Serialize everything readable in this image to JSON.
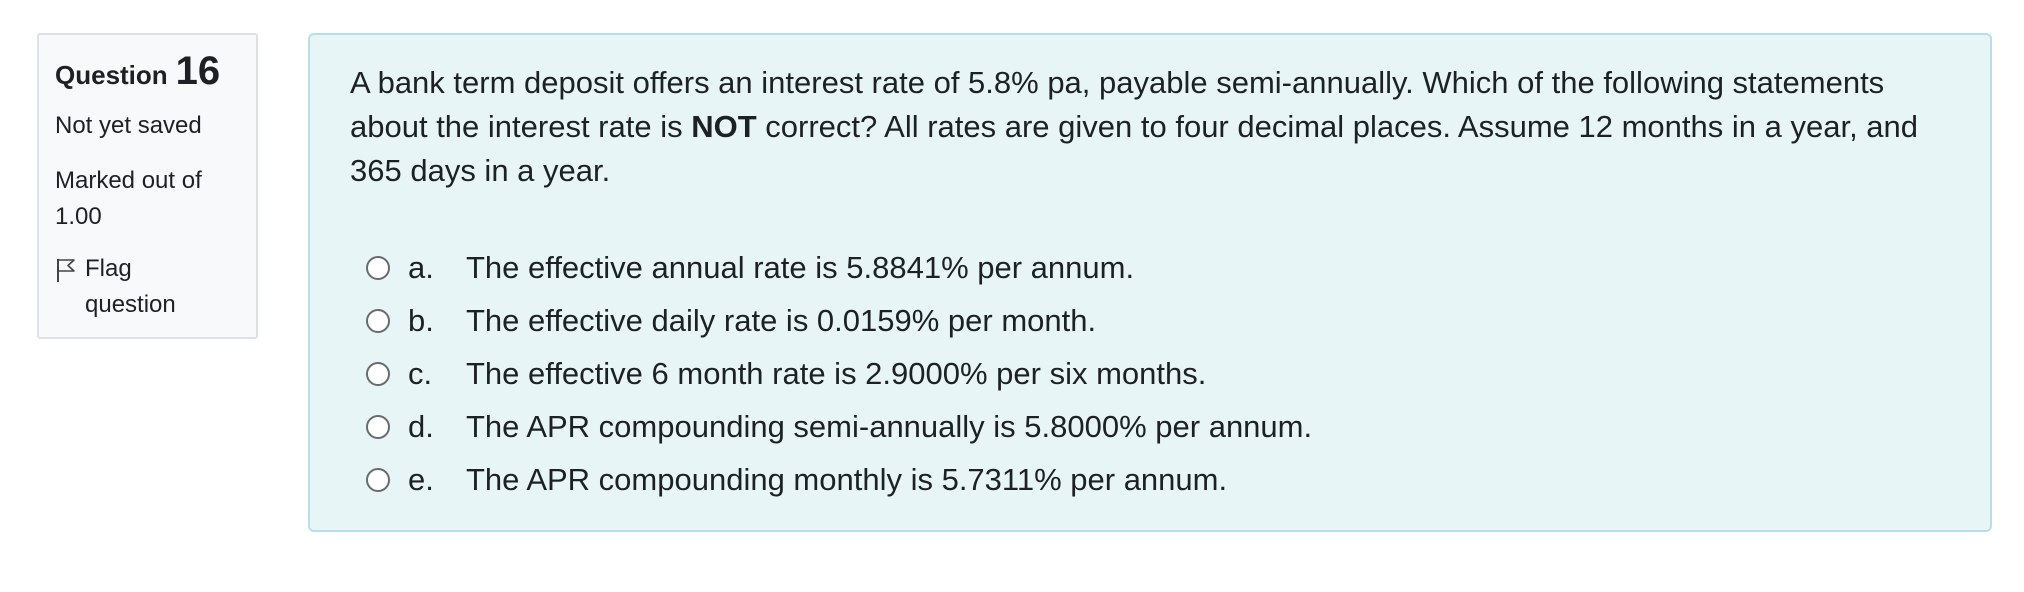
{
  "info": {
    "question_label": "Question",
    "question_number": "16",
    "state": "Not yet saved",
    "marks_line1": "Marked out of",
    "marks_line2": "1.00",
    "flag_line1": "Flag",
    "flag_line2": "question",
    "flag_icon": "flag-outline-icon"
  },
  "question": {
    "text_part1": "A bank term deposit offers an interest rate of 5.8% pa, payable semi-annually. Which of the following statements about the interest rate is ",
    "text_bold": "NOT",
    "text_part2": " correct? All rates are given to four decimal places. Assume 12 months in a year, and 365 days in a year.",
    "answers": [
      {
        "letter": "a.",
        "text": "The effective annual rate is 5.8841% per annum."
      },
      {
        "letter": "b.",
        "text": "The effective daily rate is 0.0159% per month."
      },
      {
        "letter": "c.",
        "text": "The effective 6 month rate is 2.9000% per six months."
      },
      {
        "letter": "d.",
        "text": "The APR compounding semi-annually is 5.8000% per annum."
      },
      {
        "letter": "e.",
        "text": "The APR compounding monthly is 5.7311% per annum."
      }
    ]
  },
  "colors": {
    "content_bg": "#e8f5f7",
    "content_border": "#b8dfe8",
    "info_bg": "#f8f9fa"
  }
}
